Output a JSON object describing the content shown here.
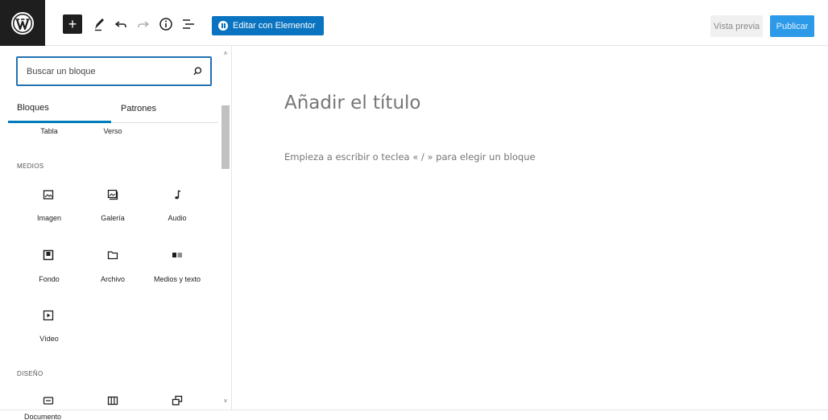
{
  "toolbar": {
    "elementor_label": "Editar con Elementor",
    "preview_label": "Vista previa",
    "publish_label": "Publicar"
  },
  "inserter": {
    "search_placeholder": "Buscar un bloque",
    "tabs": [
      {
        "label": "Bloques",
        "active": true
      },
      {
        "label": "Patrones",
        "active": false
      }
    ],
    "partial_row": [
      "Tabla",
      "Verso"
    ],
    "categories": [
      {
        "title": "MEDIOS",
        "items": [
          {
            "label": "Imagen",
            "icon": "image-icon"
          },
          {
            "label": "Galería",
            "icon": "gallery-icon"
          },
          {
            "label": "Audio",
            "icon": "audio-icon"
          },
          {
            "label": "Fondo",
            "icon": "cover-icon"
          },
          {
            "label": "Archivo",
            "icon": "file-icon"
          },
          {
            "label": "Medios y texto",
            "icon": "media-text-icon"
          },
          {
            "label": "Vídeo",
            "icon": "video-icon"
          }
        ]
      },
      {
        "title": "DISEÑO",
        "items": [
          {
            "label": "Documento",
            "icon": "document-icon"
          },
          {
            "label": "",
            "icon": "columns-icon"
          },
          {
            "label": "",
            "icon": "group-icon"
          }
        ]
      }
    ]
  },
  "editor": {
    "title_placeholder": "Añadir el título",
    "body_placeholder": "Empieza a escribir o teclea « / » para elegir un bloque"
  },
  "colors": {
    "accent": "#007cba",
    "elementor": "#0a74c0",
    "publish": "#2c9ae8"
  }
}
